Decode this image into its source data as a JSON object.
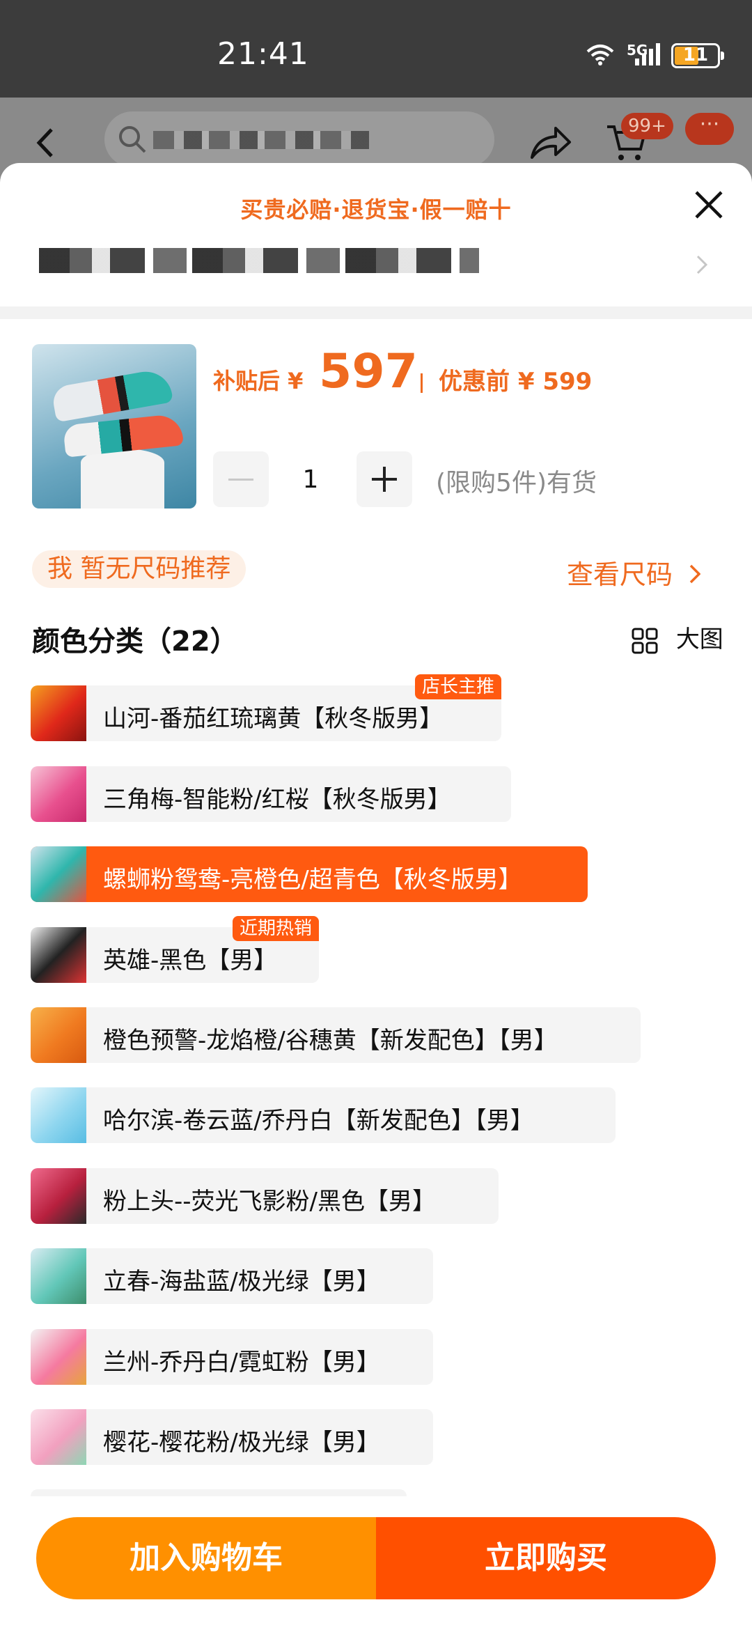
{
  "status_bar": {
    "time": "21:41",
    "network": "5G",
    "battery": "11"
  },
  "nav": {
    "cart_badge": "99+",
    "more_label": "···"
  },
  "sheet": {
    "guarantee": "买贵必赔·退货宝·假一赔十",
    "price": {
      "after_subsidy_label": "补贴后 ¥",
      "after_subsidy_value": "597",
      "before_discount": "优惠前 ¥ 599"
    },
    "quantity": "1",
    "stock_text": "(限购5件)有货",
    "size_recommend": "我 暂无尺码推荐",
    "size_link": "查看尺码",
    "color_section_title": "颜色分类（22）",
    "big_view_label": "大图",
    "colors": [
      {
        "label": "山河-番茄红琉璃黄【秋冬版男】",
        "tag": "店长主推"
      },
      {
        "label": "三角梅-智能粉/红桜【秋冬版男】",
        "tag": ""
      },
      {
        "label": "螺蛳粉鸳鸯-亮橙色/超青色【秋冬版男】",
        "tag": ""
      },
      {
        "label": "英雄-黑色【男】",
        "tag": "近期热销"
      },
      {
        "label": "橙色预警-龙焰橙/谷穗黄【新发配色】【男】",
        "tag": ""
      },
      {
        "label": "哈尔滨-卷云蓝/乔丹白【新发配色】【男】",
        "tag": ""
      },
      {
        "label": "粉上头--荧光飞影粉/黑色【男】",
        "tag": ""
      },
      {
        "label": "立春-海盐蓝/极光绿【男】",
        "tag": ""
      },
      {
        "label": "兰州-乔丹白/霓虹粉【男】",
        "tag": ""
      },
      {
        "label": "樱花-樱花粉/极光绿【男】",
        "tag": ""
      }
    ]
  },
  "actions": {
    "add_to_cart": "加入购物车",
    "buy_now": "立即购买"
  },
  "colors": {
    "accent": "#ef6a1f",
    "selected": "#ff5a10",
    "cart_button": "#ff9000",
    "buy_button": "#ff5000"
  }
}
